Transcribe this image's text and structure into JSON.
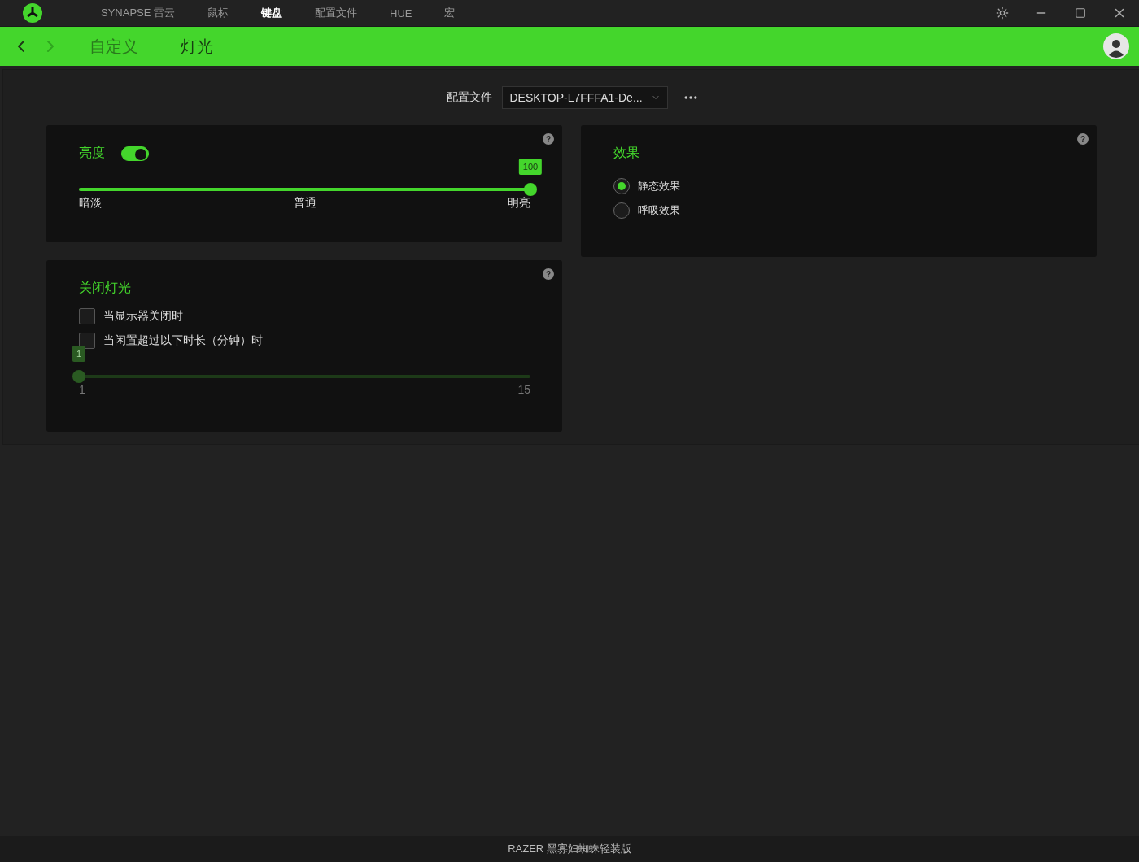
{
  "top_tabs": [
    {
      "label": "SYNAPSE 雷云",
      "selected": false
    },
    {
      "label": "鼠标",
      "selected": false
    },
    {
      "label": "键盘",
      "selected": true
    },
    {
      "label": "配置文件",
      "selected": false
    },
    {
      "label": "HUE",
      "selected": false
    },
    {
      "label": "宏",
      "selected": false
    }
  ],
  "sub_nav": {
    "back_disabled": false,
    "forward_disabled": true,
    "tabs": [
      {
        "label": "自定义",
        "selected": false
      },
      {
        "label": "灯光",
        "selected": true
      }
    ]
  },
  "profile": {
    "label": "配置文件",
    "value": "DESKTOP-L7FFFA1-De..."
  },
  "brightness": {
    "title": "亮度",
    "help": "?",
    "on": true,
    "badge": "100",
    "level": 1,
    "labels": [
      "暗淡",
      "普通",
      "明亮"
    ]
  },
  "lights_off": {
    "title": "关闭灯光",
    "help": "?",
    "options": [
      {
        "label": "当显示器关闭时",
        "checked": false
      },
      {
        "label": "当闲置超过以下时长（分钟）时",
        "checked": false
      }
    ],
    "slider": {
      "badge": "1",
      "level": 0,
      "disabled": true,
      "min_label": "1",
      "max_label": "15"
    }
  },
  "effect": {
    "title": "效果",
    "help": "?",
    "options": [
      {
        "label": "静态效果",
        "selected": true
      },
      {
        "label": "呼吸效果",
        "selected": false
      }
    ]
  },
  "status_bar": "RAZER 黑寡妇蜘蛛轻装版"
}
